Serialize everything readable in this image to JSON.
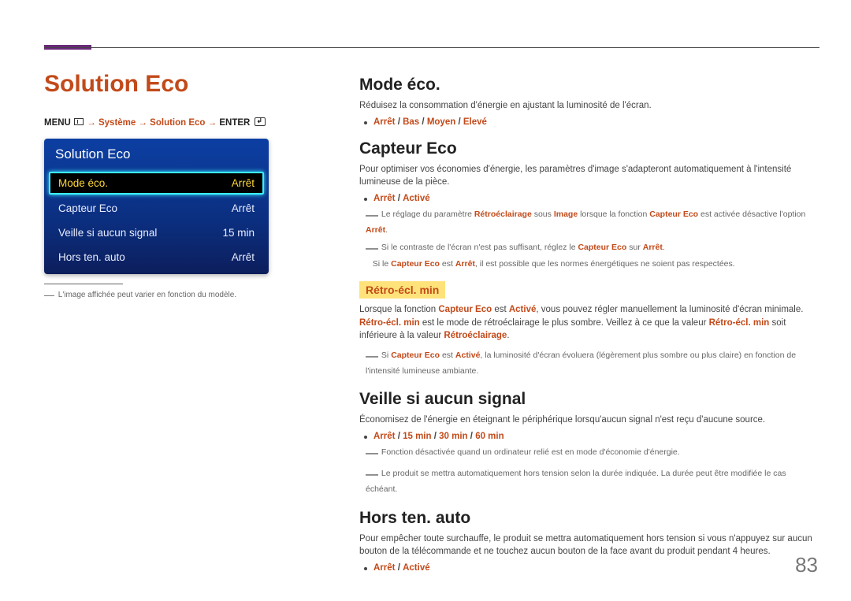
{
  "page_number": "83",
  "left": {
    "title": "Solution Eco",
    "breadcrumb": {
      "prefix": "MENU",
      "path": " → Système → Solution Eco → ",
      "suffix": "ENTER"
    },
    "menu": {
      "title": "Solution Eco",
      "items": [
        {
          "label": "Mode éco.",
          "value": "Arrêt",
          "selected": true
        },
        {
          "label": "Capteur Eco",
          "value": "Arrêt",
          "selected": false
        },
        {
          "label": "Veille si aucun signal",
          "value": "15 min",
          "selected": false
        },
        {
          "label": "Hors ten. auto",
          "value": "Arrêt",
          "selected": false
        }
      ]
    },
    "footnote": "L'image affichée peut varier en fonction du modèle."
  },
  "right": {
    "mode_eco": {
      "heading": "Mode éco.",
      "desc": "Réduisez la consommation d'énergie en ajustant la luminosité de l'écran.",
      "opts": [
        "Arrêt",
        "Bas",
        "Moyen",
        "Elevé"
      ]
    },
    "capteur_eco": {
      "heading": "Capteur Eco",
      "desc": "Pour optimiser vos économies d'énergie, les paramètres d'image s'adapteront automatiquement à l'intensité lumineuse de la pièce.",
      "opts": [
        "Arrêt",
        "Activé"
      ],
      "note1_pre": "Le réglage du paramètre ",
      "note1_k1": "Rétroéclairage",
      "note1_mid1": " sous ",
      "note1_k2": "Image",
      "note1_mid2": " lorsque la fonction ",
      "note1_k3": "Capteur Eco",
      "note1_mid3": " est activée désactive l'option ",
      "note1_k4": "Arrêt",
      "note1_post": ".",
      "note2_pre": "Si le contraste de l'écran n'est pas suffisant, réglez le ",
      "note2_k1": "Capteur Eco",
      "note2_mid": " sur ",
      "note2_k2": "Arrêt",
      "note2_post": ".",
      "note2_line2_pre": "Si le ",
      "note2_line2_k1": "Capteur Eco",
      "note2_line2_mid": " est ",
      "note2_line2_k2": "Arrêt",
      "note2_line2_post": ", il est possible que les normes énergétiques ne soient pas respectées.",
      "sub": {
        "heading": "Rétro-écl. min",
        "desc_pre": "Lorsque la fonction ",
        "desc_k1": "Capteur Eco",
        "desc_mid1": " est ",
        "desc_k2": "Activé",
        "desc_mid2": ", vous pouvez régler manuellement la luminosité d'écran minimale. ",
        "desc_k3": "Rétro-écl. min",
        "desc_mid3": " est le mode de rétroéclairage le plus sombre. Veillez à ce que la valeur ",
        "desc_k4": "Rétro-écl. min",
        "desc_mid4": " soit inférieure à la valeur ",
        "desc_k5": "Rétroéclairage",
        "desc_post": ".",
        "note_pre": "Si ",
        "note_k1": "Capteur Eco",
        "note_mid1": " est ",
        "note_k2": "Activé",
        "note_post": ", la luminosité d'écran évoluera (légèrement plus sombre ou plus claire) en fonction de l'intensité lumineuse ambiante."
      }
    },
    "veille": {
      "heading": "Veille si aucun signal",
      "desc": "Économisez de l'énergie en éteignant le périphérique lorsqu'aucun signal n'est reçu d'aucune source.",
      "opts": [
        "Arrêt",
        "15 min",
        "30 min",
        "60 min"
      ],
      "note1": "Fonction désactivée quand un ordinateur relié est en mode d'économie d'énergie.",
      "note2": "Le produit se mettra automatiquement hors tension selon la durée indiquée. La durée peut être modifiée le cas échéant."
    },
    "hors_ten": {
      "heading": "Hors ten. auto",
      "desc": "Pour empêcher toute surchauffe, le produit se mettra automatiquement hors tension si vous n'appuyez sur aucun bouton de la télécommande et ne touchez aucun bouton de la face avant du produit pendant 4 heures.",
      "opts": [
        "Arrêt",
        "Activé"
      ]
    }
  }
}
